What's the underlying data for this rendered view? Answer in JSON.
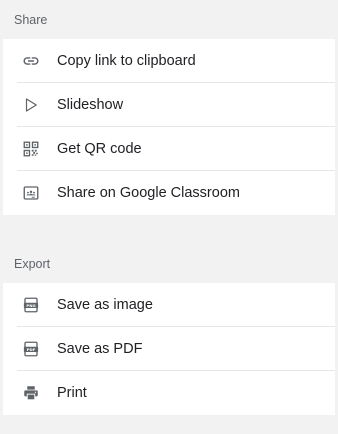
{
  "share": {
    "header": "Share",
    "items": [
      {
        "label": "Copy link to clipboard",
        "icon": "link-icon"
      },
      {
        "label": "Slideshow",
        "icon": "play-icon"
      },
      {
        "label": "Get QR code",
        "icon": "qr-code-icon"
      },
      {
        "label": "Share on Google Classroom",
        "icon": "classroom-icon"
      }
    ]
  },
  "export": {
    "header": "Export",
    "items": [
      {
        "label": "Save as image",
        "icon": "png-file-icon"
      },
      {
        "label": "Save as PDF",
        "icon": "pdf-file-icon"
      },
      {
        "label": "Print",
        "icon": "printer-icon"
      }
    ]
  }
}
